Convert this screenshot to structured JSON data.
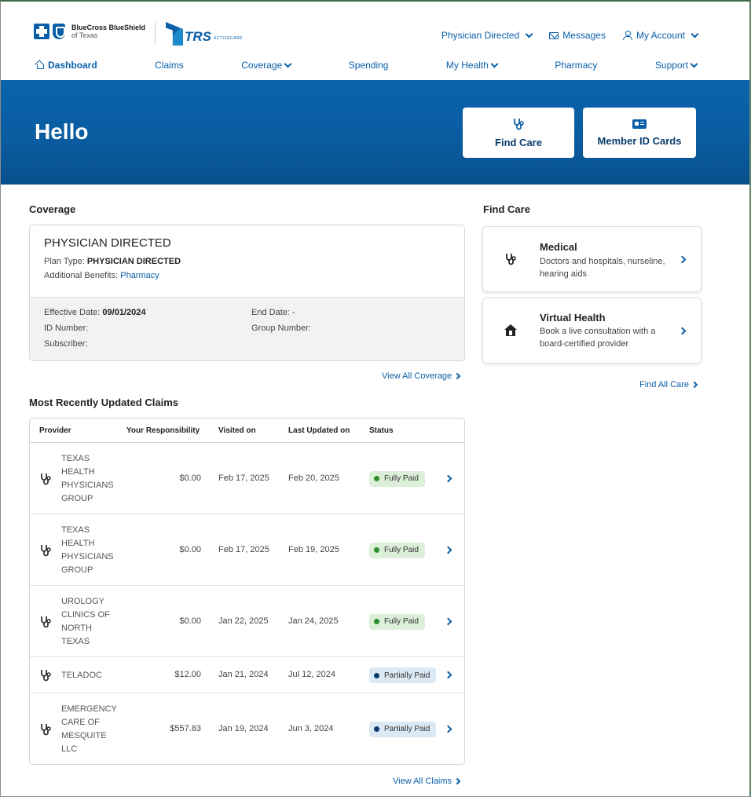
{
  "header": {
    "brand_line1": "BlueCross BlueShield",
    "brand_line2": "of Texas",
    "trs_text": "TRS",
    "trs_sub": "ACTIVECARE",
    "util": {
      "plan": "Physician Directed",
      "messages": "Messages",
      "account": "My Account"
    },
    "nav": {
      "dashboard": "Dashboard",
      "claims": "Claims",
      "coverage": "Coverage",
      "spending": "Spending",
      "my_health": "My Health",
      "pharmacy": "Pharmacy",
      "support": "Support"
    }
  },
  "hero": {
    "title": "Hello",
    "find_care": "Find Care",
    "id_cards": "Member ID Cards"
  },
  "coverage": {
    "section_title": "Coverage",
    "plan_name": "PHYSICIAN DIRECTED",
    "plan_type_label": "Plan Type:",
    "plan_type_value": "PHYSICIAN DIRECTED",
    "benefits_label": "Additional Benefits:",
    "benefits_value": "Pharmacy",
    "effective_label": "Effective Date:",
    "effective_value": "09/01/2024",
    "end_label": "End Date:",
    "end_value": "-",
    "id_label": "ID Number:",
    "group_label": "Group Number:",
    "subscriber_label": "Subscriber:",
    "view_all": "View All Coverage"
  },
  "claims": {
    "section_title": "Most Recently Updated Claims",
    "headers": {
      "provider": "Provider",
      "responsibility": "Your Responsibility",
      "visited": "Visited on",
      "updated": "Last Updated on",
      "status": "Status"
    },
    "rows": [
      {
        "provider": "TEXAS HEALTH PHYSICIANS GROUP",
        "lines": [
          "TEXAS",
          "HEALTH",
          "PHYSICIANS",
          "GROUP"
        ],
        "responsibility": "$0.00",
        "visited": "Feb 17, 2025",
        "updated": "Feb 20, 2025",
        "status": "Fully Paid"
      },
      {
        "provider": "TEXAS HEALTH PHYSICIANS GROUP",
        "lines": [
          "TEXAS",
          "HEALTH",
          "PHYSICIANS",
          "GROUP"
        ],
        "responsibility": "$0.00",
        "visited": "Feb 17, 2025",
        "updated": "Feb 19, 2025",
        "status": "Fully Paid"
      },
      {
        "provider": "UROLOGY CLINICS OF NORTH TEXAS",
        "lines": [
          "UROLOGY",
          "CLINICS OF",
          "NORTH",
          "TEXAS"
        ],
        "responsibility": "$0.00",
        "visited": "Jan 22, 2025",
        "updated": "Jan 24, 2025",
        "status": "Fully Paid"
      },
      {
        "provider": "TELADOC",
        "lines": [
          "TELADOC"
        ],
        "responsibility": "$12.00",
        "visited": "Jan 21, 2024",
        "updated": "Jul 12, 2024",
        "status": "Partially Paid"
      },
      {
        "provider": "EMERGENCY CARE OF MESQUITE LLC",
        "lines": [
          "EMERGENCY",
          "CARE OF",
          "MESQUITE",
          "LLC"
        ],
        "responsibility": "$557.83",
        "visited": "Jan 19, 2024",
        "updated": "Jun 3, 2024",
        "status": "Partially Paid"
      }
    ],
    "view_all": "View All Claims"
  },
  "find_care": {
    "section_title": "Find Care",
    "medical_title": "Medical",
    "medical_desc": "Doctors and hospitals, nurseline, hearing aids",
    "virtual_title": "Virtual Health",
    "virtual_desc": "Book a live consultation with a board-certified provider",
    "find_all": "Find All Care"
  },
  "colors": {
    "brand_blue": "#0a5fa8",
    "hero_blue": "#0a5b9f",
    "paid_green": "#2c8f2c",
    "partial_navy": "#0b3c6d"
  },
  "icons": [
    "stethoscope-icon",
    "id-card-icon",
    "home-icon",
    "envelope-icon",
    "person-icon",
    "house-medical-icon",
    "chevron-down-icon",
    "chevron-right-icon"
  ]
}
